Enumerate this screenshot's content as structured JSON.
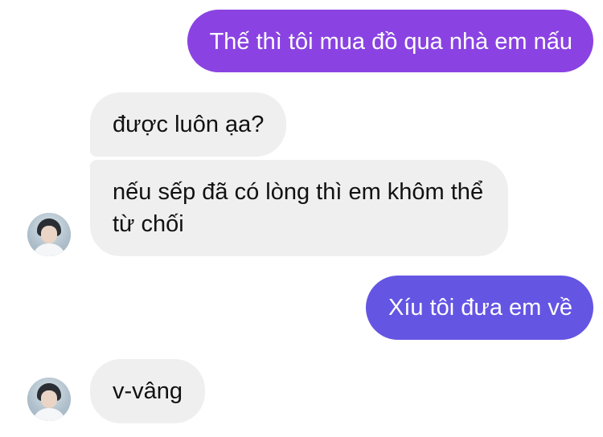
{
  "conversation": {
    "messages": [
      {
        "sender": "me",
        "text": "Thế thì tôi mua đồ qua nhà em nấu",
        "bubble_color": "#8a43e2"
      },
      {
        "sender": "them",
        "text": "được luôn ạa?"
      },
      {
        "sender": "them",
        "text": "nếu sếp đã có lòng thì em khôm thể từ chối"
      },
      {
        "sender": "me",
        "text": "Xíu tôi đưa em về",
        "bubble_color": "#6455e3"
      },
      {
        "sender": "them",
        "text": "v-vâng"
      }
    ],
    "received_bubble_color": "#efefef",
    "contact_avatar_icon": "profile-photo-icon"
  }
}
